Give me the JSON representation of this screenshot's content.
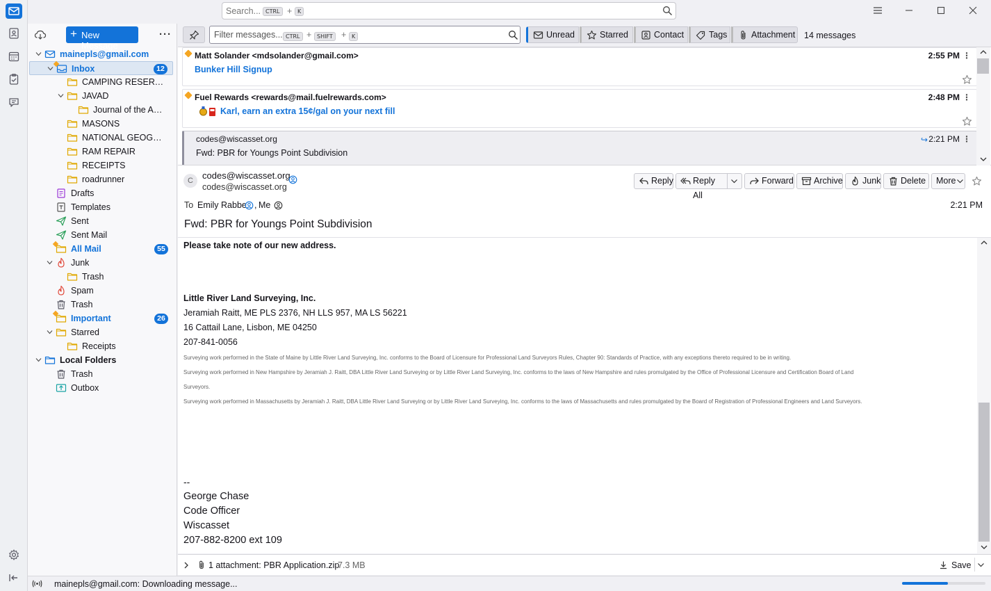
{
  "search": {
    "placeholder": "Search...",
    "key1": "CTRL",
    "plus": "+",
    "key2": "K"
  },
  "folders": {
    "new_message": "New Message",
    "account": "mainepls@gmail.com",
    "items": [
      {
        "label": "Inbox",
        "badge": "12"
      },
      {
        "label": "CAMPING RESERVATI..."
      },
      {
        "label": "JAVAD"
      },
      {
        "label": "Journal of the Am..."
      },
      {
        "label": "MASONS"
      },
      {
        "label": "NATIONAL GEOGRA..."
      },
      {
        "label": "RAM REPAIR"
      },
      {
        "label": "RECEIPTS"
      },
      {
        "label": "roadrunner"
      },
      {
        "label": "Drafts"
      },
      {
        "label": "Templates"
      },
      {
        "label": "Sent"
      },
      {
        "label": "Sent Mail"
      },
      {
        "label": "All Mail",
        "badge": "55"
      },
      {
        "label": "Junk"
      },
      {
        "label": "Trash"
      },
      {
        "label": "Spam"
      },
      {
        "label": "Trash"
      },
      {
        "label": "Important",
        "badge": "26"
      },
      {
        "label": "Starred"
      },
      {
        "label": "Receipts"
      },
      {
        "label": "Local Folders"
      },
      {
        "label": "Trash"
      },
      {
        "label": "Outbox"
      }
    ]
  },
  "quickfilter": {
    "placeholder": "Filter messages...",
    "key1": "CTRL",
    "key2": "SHIFT",
    "key3": "K",
    "plus": "+",
    "unread": "Unread",
    "starred": "Starred",
    "contact": "Contact",
    "tags": "Tags",
    "attachment": "Attachment",
    "count": "14 messages"
  },
  "messages": [
    {
      "from": "Matt Solander <mdsolander@gmail.com>",
      "subject": "Bunker Hill Signup",
      "time": "2:55 PM"
    },
    {
      "from": "Fuel Rewards <rewards@mail.fuelrewards.com>",
      "subject": "Karl, earn an extra 15¢/gal on your next fill",
      "time": "2:48 PM"
    },
    {
      "from": "codes@wiscasset.org",
      "subject": "Fwd: PBR for Youngs Point Subdivision",
      "time": "2:21 PM"
    }
  ],
  "header": {
    "avatar_letter": "C",
    "from_name": "codes@wiscasset.org",
    "from_email": "codes@wiscasset.org",
    "to_label": "To",
    "to_1": "Emily Rabbe",
    "to_sep": ",",
    "to_2": "Me",
    "date": "2:21 PM",
    "subject": "Fwd: PBR for Youngs Point Subdivision",
    "buttons": {
      "reply": "Reply",
      "reply_all": "Reply All",
      "forward": "Forward",
      "archive": "Archive",
      "junk": "Junk",
      "delete": "Delete",
      "more": "More"
    }
  },
  "body": {
    "notice": "Please take note of our new address.",
    "company": "Little River Land Surveying, Inc.",
    "line1": "Jeramiah Raitt, ME PLS 2376, NH LLS 957, MA LS 56221",
    "line2": "16 Cattail Lane, Lisbon, ME 04250",
    "line3": "207-841-0056",
    "disc1": "Surveying work performed in the State of Maine by Little River Land Surveying, Inc. conforms to the Board of Licensure for Professional Land Surveyors Rules, Chapter 90: Standards of Practice, with any exceptions thereto required to be in writing.",
    "disc2a": "Surveying work performed in New Hampshire by Jeramiah J. Raitt, DBA Little River Land Surveying or by Little River Land Surveying, Inc. conforms to the laws of New Hampshire and rules promulgated by the Office of Professional Licensure and Certification Board of Land",
    "disc2b": "Surveyors.",
    "disc3": "Surveying work performed in Massachusetts by Jeramiah J. Raitt, DBA Little River Land Surveying or by Little River Land Surveying, Inc. conforms to the laws of Massachusetts and rules promulgated by the Board of Registration of Professional Engineers and Land Surveyors.",
    "sig_dash": "--",
    "sig_name": "George Chase",
    "sig_title": "Code Officer",
    "sig_org": "Wiscasset",
    "sig_phone": "207-882-8200 ext 109"
  },
  "attachment": {
    "label": "1 attachment: PBR Application.zip",
    "size": "7.3 MB",
    "save": "Save"
  },
  "status": {
    "text": "mainepls@gmail.com: Downloading message...",
    "progress": 0.55
  },
  "colors": {
    "accent": "#1373d9",
    "folder": "#f6c343",
    "junk": "#e0483a"
  }
}
